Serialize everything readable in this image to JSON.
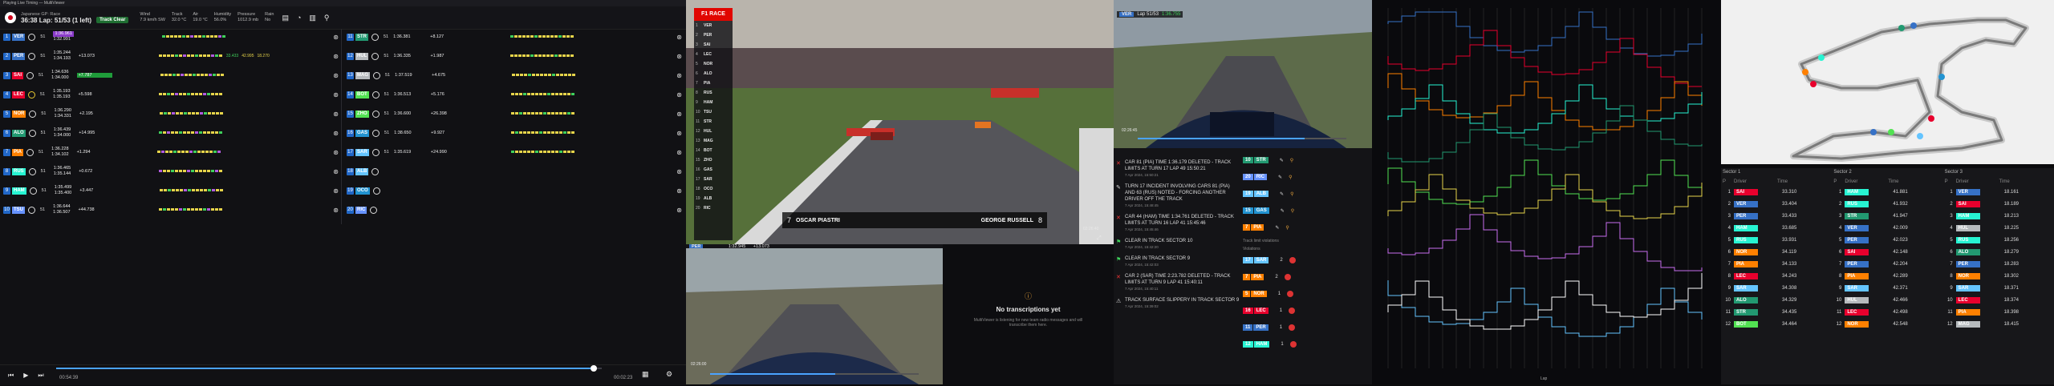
{
  "timing": {
    "window_title": "Playing Live Timing — MultiViewer",
    "session": "Japanese GP: Race",
    "clock": "36:38",
    "laps": "Lap: 51/53 (1 left)",
    "track_status": "Track Clear",
    "weather": {
      "wind_label": "Wind",
      "wind": "7.9 km/h SW",
      "track_label": "Track",
      "track": "32.0 °C",
      "air_label": "Air",
      "air": "19.0 °C",
      "humidity_label": "Humidity",
      "humidity": "56.0%",
      "pressure_label": "Pressure",
      "pressure": "1012.9 mb",
      "rain_label": "Rain",
      "rain": "No"
    },
    "drivers_left": [
      {
        "pos": "1",
        "code": "VER",
        "color": "#3671c6",
        "lap": "51",
        "last": "1:36.961",
        "best": "1:32.991",
        "gap": "",
        "s1": "",
        "s2": "",
        "s3": "",
        "tyre": "h"
      },
      {
        "pos": "2",
        "code": "PER",
        "color": "#3671c6",
        "lap": "51",
        "last": "1:35.244",
        "best": "1:34.193",
        "gap": "+13.073",
        "s1": "33.433",
        "s2": "42.995",
        "s3": "18.270",
        "tyre": "h"
      },
      {
        "pos": "3",
        "code": "SAI",
        "color": "#e8002d",
        "lap": "51",
        "last": "1:34.636",
        "best": "1:34.000",
        "gap": "+7.787",
        "s1": "",
        "s2": "",
        "s3": "",
        "tyre": "h"
      },
      {
        "pos": "4",
        "code": "LEC",
        "color": "#e8002d",
        "lap": "51",
        "last": "1:35.193",
        "best": "1:35.193",
        "gap": "+5.598",
        "s1": "",
        "s2": "",
        "s3": "",
        "tyre": "m"
      },
      {
        "pos": "5",
        "code": "NOR",
        "color": "#ff8000",
        "lap": "51",
        "last": "1:36.290",
        "best": "1:34.331",
        "gap": "+2.195",
        "s1": "",
        "s2": "",
        "s3": "",
        "tyre": "h"
      },
      {
        "pos": "6",
        "code": "ALO",
        "color": "#229971",
        "lap": "51",
        "last": "1:36.439",
        "best": "1:34.000",
        "gap": "+14.995",
        "s1": "",
        "s2": "",
        "s3": "",
        "tyre": "h"
      },
      {
        "pos": "7",
        "code": "PIA",
        "color": "#ff8000",
        "lap": "51",
        "last": "1:36.228",
        "best": "1:34.102",
        "gap": "+1.294",
        "s1": "",
        "s2": "",
        "s3": "",
        "tyre": "h"
      },
      {
        "pos": "8",
        "code": "RUS",
        "color": "#27f4d2",
        "lap": "51",
        "last": "1:36.465",
        "best": "1:35.144",
        "gap": "+0.672",
        "s1": "",
        "s2": "",
        "s3": "",
        "tyre": "h"
      },
      {
        "pos": "9",
        "code": "HAM",
        "color": "#27f4d2",
        "lap": "51",
        "last": "1:35.499",
        "best": "1:35.400",
        "gap": "+3.447",
        "s1": "",
        "s2": "",
        "s3": "",
        "tyre": "h"
      },
      {
        "pos": "10",
        "code": "TSU",
        "color": "#6692ff",
        "lap": "51",
        "last": "1:36.644",
        "best": "1:36.507",
        "gap": "+44.738",
        "s1": "",
        "s2": "",
        "s3": "",
        "tyre": "h"
      }
    ],
    "drivers_right": [
      {
        "pos": "11",
        "code": "STR",
        "color": "#229971",
        "lap": "51",
        "last": "1:36.381",
        "gap": "+8.127"
      },
      {
        "pos": "12",
        "code": "HUL",
        "color": "#b6babd",
        "lap": "51",
        "last": "1:36.335",
        "gap": "+1.987"
      },
      {
        "pos": "13",
        "code": "MAG",
        "color": "#b6babd",
        "lap": "51",
        "last": "1:37.519",
        "gap": "+4.675"
      },
      {
        "pos": "14",
        "code": "BOT",
        "color": "#52e252",
        "lap": "51",
        "last": "1:36.513",
        "gap": "+5.176"
      },
      {
        "pos": "15",
        "code": "ZHO",
        "color": "#52e252",
        "lap": "51",
        "last": "1:36.600",
        "gap": "+26.398"
      },
      {
        "pos": "16",
        "code": "GAS",
        "color": "#2293d1",
        "lap": "51",
        "last": "1:38.650",
        "gap": "+9.927"
      },
      {
        "pos": "17",
        "code": "SAR",
        "color": "#64c4ff",
        "lap": "51",
        "last": "1:35.619",
        "gap": "+24.990"
      },
      {
        "pos": "18",
        "code": "ALB",
        "color": "#64c4ff",
        "lap": "",
        "last": "",
        "gap": ""
      },
      {
        "pos": "19",
        "code": "OCO",
        "color": "#2293d1",
        "lap": "",
        "last": "",
        "gap": ""
      },
      {
        "pos": "20",
        "code": "RIC",
        "color": "#6692ff",
        "lap": "",
        "last": "",
        "gap": ""
      }
    ],
    "player": {
      "elapsed": "00:54:39",
      "remaining": "00:02:23"
    }
  },
  "video_main": {
    "logo": "F1 RACE",
    "tower": [
      "VER",
      "PER",
      "SAI",
      "LEC",
      "NOR",
      "ALO",
      "PIA",
      "RUS",
      "HAM",
      "TSU",
      "STR",
      "HUL",
      "MAG",
      "BOT",
      "ZHO",
      "GAS",
      "SAR",
      "OCO",
      "ALB",
      "RIC"
    ],
    "caption_left_pos": "7",
    "caption_left": "OSCAR PIASTRI",
    "caption_right": "GEORGE RUSSELL",
    "caption_right_pos": "8",
    "time": "02:26:40"
  },
  "video_onboard_top": {
    "driver": "VER",
    "lap": "Lap 51/53",
    "time": "1:36.755",
    "elapsed": "02:26:45"
  },
  "video_onboard_bottom": {
    "driver": "PER",
    "best": "1:32.945",
    "gap": "+13.073",
    "elapsed": "02:26:00"
  },
  "transcriptions": {
    "title": "No transcriptions yet",
    "body": "MultiViewer is listening for new team radio messages and will transcribe them here."
  },
  "race_control": [
    {
      "text": "CAR 81 (PIA) TIME 1:36.179 DELETED - TRACK LIMITS AT TURN 17 LAP 49 15:50:21",
      "ts": "7 Apr 2024, 15:50:21"
    },
    {
      "text": "TURN 17 INCIDENT INVOLVING CARS 81 (PIA) AND 63 (RUS) NOTED - FORCING ANOTHER DRIVER OFF THE TRACK",
      "ts": "7 Apr 2024, 15:48:45"
    },
    {
      "text": "CAR 44 (HAM) TIME 1:34.761 DELETED - TRACK LIMITS AT TURN 16 LAP 41 15:45:46",
      "ts": "7 Apr 2024, 15:45:46"
    },
    {
      "text": "CLEAR IN TRACK SECTOR 10",
      "ts": "7 Apr 2024, 15:42:20"
    },
    {
      "text": "CLEAR IN TRACK SECTOR 9",
      "ts": "7 Apr 2024, 15:42:03"
    },
    {
      "text": "CAR 2 (SAR) TIME 2:23.782 DELETED - TRACK LIMITS AT TURN 9 LAP 41 15:40:11",
      "ts": "7 Apr 2024, 15:40:11"
    },
    {
      "text": "TRACK SURFACE SLIPPERY IN TRACK SECTOR 9",
      "ts": "7 Apr 2024, 15:39:02"
    }
  ],
  "penalties_top": [
    {
      "pos": "10",
      "code": "STR",
      "color": "#229971"
    },
    {
      "pos": "20",
      "code": "RIC",
      "color": "#6692ff"
    },
    {
      "pos": "19",
      "code": "ALB",
      "color": "#64c4ff"
    },
    {
      "pos": "15",
      "code": "GAS",
      "color": "#2293d1"
    },
    {
      "pos": "7",
      "code": "PIA",
      "color": "#ff8000"
    }
  ],
  "penalties_label": "Track limit violations",
  "penalties_header": "Violations",
  "penalties_bottom": [
    {
      "pos": "17",
      "code": "SAR",
      "color": "#64c4ff",
      "n": "2"
    },
    {
      "pos": "7",
      "code": "PIA",
      "color": "#ff8000",
      "n": "2"
    },
    {
      "pos": "5",
      "code": "NOR",
      "color": "#ff8000",
      "n": "1"
    },
    {
      "pos": "16",
      "code": "LEC",
      "color": "#e8002d",
      "n": "1"
    },
    {
      "pos": "11",
      "code": "PER",
      "color": "#3671c6",
      "n": "1"
    },
    {
      "pos": "12",
      "code": "HAM",
      "color": "#27f4d2",
      "n": "1"
    }
  ],
  "sectors": {
    "headers": [
      "Sector 1",
      "Sector 2",
      "Sector 3"
    ],
    "col_labels": [
      "P",
      "Driver",
      "Time"
    ],
    "s1": [
      {
        "pos": "1",
        "code": "SAI",
        "color": "#e8002d",
        "time": "33.310"
      },
      {
        "pos": "2",
        "code": "VER",
        "color": "#3671c6",
        "time": "33.404"
      },
      {
        "pos": "3",
        "code": "PER",
        "color": "#3671c6",
        "time": "33.433"
      },
      {
        "pos": "4",
        "code": "HAM",
        "color": "#27f4d2",
        "time": "33.685"
      },
      {
        "pos": "5",
        "code": "RUS",
        "color": "#27f4d2",
        "time": "33.931"
      },
      {
        "pos": "6",
        "code": "NOR",
        "color": "#ff8000",
        "time": "34.119"
      },
      {
        "pos": "7",
        "code": "PIA",
        "color": "#ff8000",
        "time": "34.133"
      },
      {
        "pos": "8",
        "code": "LEC",
        "color": "#e8002d",
        "time": "34.243"
      },
      {
        "pos": "9",
        "code": "SAR",
        "color": "#64c4ff",
        "time": "34.308"
      },
      {
        "pos": "10",
        "code": "ALO",
        "color": "#229971",
        "time": "34.329"
      },
      {
        "pos": "11",
        "code": "STR",
        "color": "#229971",
        "time": "34.435"
      },
      {
        "pos": "12",
        "code": "BOT",
        "color": "#52e252",
        "time": "34.464"
      }
    ],
    "s2": [
      {
        "pos": "1",
        "code": "HAM",
        "color": "#27f4d2",
        "time": "41.881"
      },
      {
        "pos": "2",
        "code": "RUS",
        "color": "#27f4d2",
        "time": "41.932"
      },
      {
        "pos": "3",
        "code": "STR",
        "color": "#229971",
        "time": "41.947"
      },
      {
        "pos": "4",
        "code": "VER",
        "color": "#3671c6",
        "time": "42.009"
      },
      {
        "pos": "5",
        "code": "PER",
        "color": "#3671c6",
        "time": "42.023"
      },
      {
        "pos": "6",
        "code": "SAI",
        "color": "#e8002d",
        "time": "42.148"
      },
      {
        "pos": "7",
        "code": "PER",
        "color": "#3671c6",
        "time": "42.204"
      },
      {
        "pos": "8",
        "code": "PIA",
        "color": "#ff8000",
        "time": "42.289"
      },
      {
        "pos": "9",
        "code": "SAR",
        "color": "#64c4ff",
        "time": "42.371"
      },
      {
        "pos": "10",
        "code": "HUL",
        "color": "#b6babd",
        "time": "42.466"
      },
      {
        "pos": "11",
        "code": "LEC",
        "color": "#e8002d",
        "time": "42.498"
      },
      {
        "pos": "12",
        "code": "NOR",
        "color": "#ff8000",
        "time": "42.548"
      }
    ],
    "s3": [
      {
        "pos": "1",
        "code": "VER",
        "color": "#3671c6",
        "time": "18.161"
      },
      {
        "pos": "2",
        "code": "SAI",
        "color": "#e8002d",
        "time": "18.189"
      },
      {
        "pos": "3",
        "code": "HAM",
        "color": "#27f4d2",
        "time": "18.213"
      },
      {
        "pos": "4",
        "code": "HUL",
        "color": "#b6babd",
        "time": "18.225"
      },
      {
        "pos": "5",
        "code": "RUS",
        "color": "#27f4d2",
        "time": "18.256"
      },
      {
        "pos": "6",
        "code": "ALO",
        "color": "#229971",
        "time": "18.279"
      },
      {
        "pos": "7",
        "code": "PER",
        "color": "#3671c6",
        "time": "18.283"
      },
      {
        "pos": "8",
        "code": "NOR",
        "color": "#ff8000",
        "time": "18.302"
      },
      {
        "pos": "9",
        "code": "SAR",
        "color": "#64c4ff",
        "time": "18.371"
      },
      {
        "pos": "10",
        "code": "LEC",
        "color": "#e8002d",
        "time": "18.374"
      },
      {
        "pos": "11",
        "code": "PIA",
        "color": "#ff8000",
        "time": "18.398"
      },
      {
        "pos": "12",
        "code": "MAG",
        "color": "#b6babd",
        "time": "18.415"
      }
    ]
  },
  "gap_chart": {
    "xlabel": "Lap"
  }
}
